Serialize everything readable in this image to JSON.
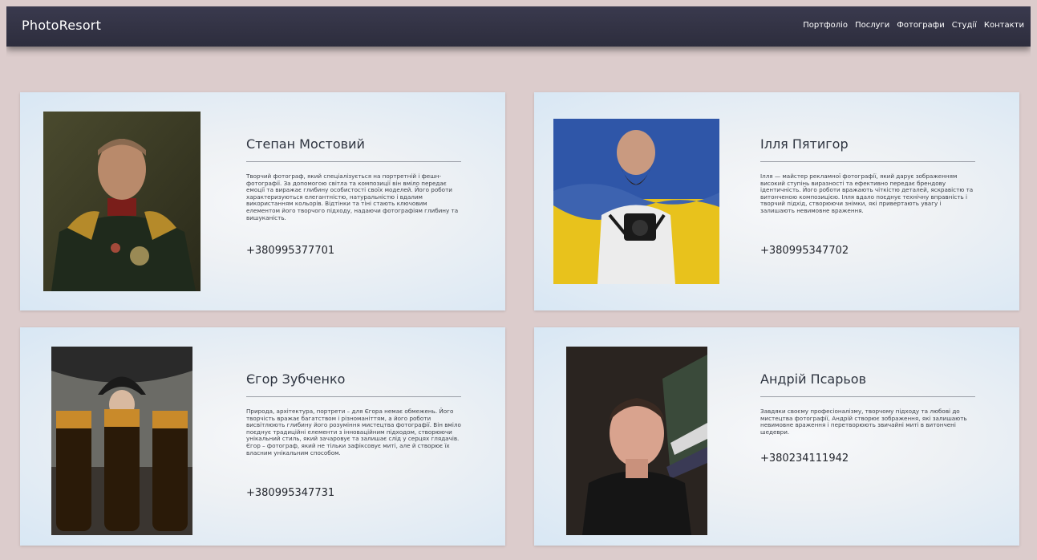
{
  "brand": "PhotoResort",
  "nav": [
    "Портфоліо",
    "Послуги",
    "Фотографи",
    "Студії",
    "Контакти"
  ],
  "photographers": [
    {
      "name": "Степан Мостовий",
      "description": "Творчий фотограф, який спеціалізується на портретній і фешн-фотографії. За допомогою світла та композиції він вміло передає емоції та виражає глибину особистості своїх моделей. Його роботи характеризуються елегантністю, натуральністю і вдалим використанням кольорів. Відтінки та тіні стають ключовим елементом його творчого підходу, надаючи фотографіям глибину та вишуканість.",
      "phone": "+380995377701"
    },
    {
      "name": "Ілля Пятигор",
      "description": "Ілля — майстер рекламної фотографії, який дарує зображенням високий ступінь виразності та ефективно передає брендову ідентичність. Його роботи вражають чіткістю деталей, яскравістю та витонченою композицією. Ілля вдало поєднує технічну вправність і творчий підхід, створюючи знімки, які привертають увагу і залишають невимовне враження.",
      "phone": "+380995347702"
    },
    {
      "name": "Єгор Зубченко",
      "description": "Природа, архітектура, портрети – для Єгора немає обмежень. Його творчість вражає багатством і різноманіттям, а його роботи висвітлюють глибину його розуміння мистецтва фотографії. Він вміло поєднує традиційні елементи з інноваційним підходом, створюючи унікальний стиль, який зачаровує та залишає слід у серцях глядачів. Єгор – фотограф, який не тільки зафіксовує миті, але й створює їх власним унікальним способом.",
      "phone": "+380995347731"
    },
    {
      "name": "Андрій Псарьов",
      "description": "Завдяки своєму професіоналізму, творчому підходу та любові до мистецтва фотографії, Андрій створює зображення, які залишають невимовне враження і перетворюють звичайні миті в витончені шедеври.",
      "phone": "+380234111942"
    }
  ]
}
